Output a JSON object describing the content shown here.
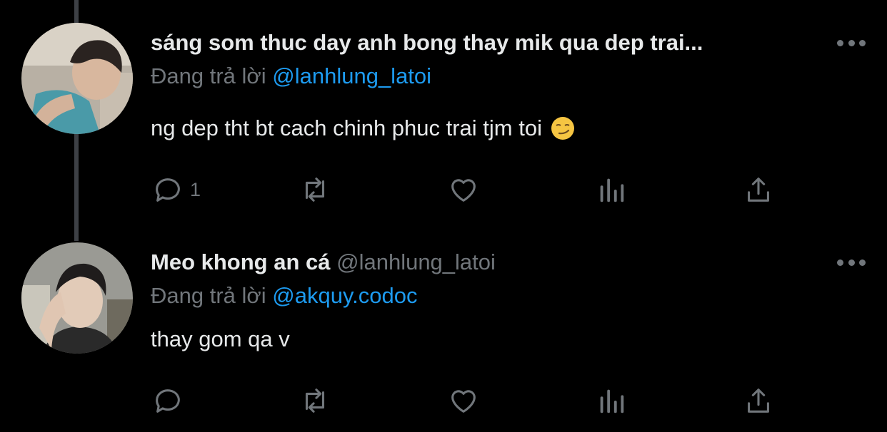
{
  "tweets": [
    {
      "name": "sáng som thuc day anh bong thay mik qua dep trai...",
      "handle": "",
      "reply_prefix": "Đang trả lời",
      "reply_to": "@lanhlung_latoi",
      "text": "ng dep tht bt cach chinh phuc trai tjm toi",
      "emoji": "smirking-face",
      "reply_count": "1"
    },
    {
      "name": "Meo khong an cá",
      "handle": "@lanhlung_latoi",
      "reply_prefix": "Đang trả lời",
      "reply_to": "@akquy.codoc",
      "text": "thay gom qa v",
      "emoji": "",
      "reply_count": ""
    }
  ],
  "colors": {
    "background": "#000000",
    "text": "#e7e9ea",
    "muted": "#71767b",
    "link": "#1d9bf0"
  },
  "icons": [
    "reply-icon",
    "retweet-icon",
    "like-icon",
    "analytics-icon",
    "share-icon",
    "more-icon"
  ]
}
